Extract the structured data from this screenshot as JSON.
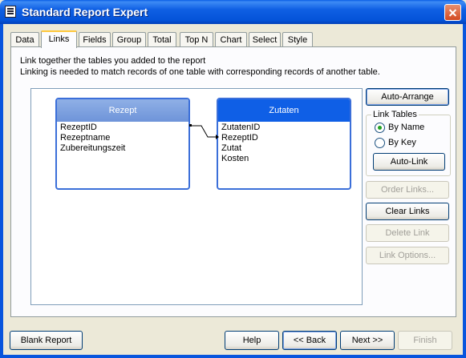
{
  "window": {
    "title": "Standard Report Expert",
    "icon": "report-app-icon",
    "close_icon": "close-icon"
  },
  "tabs": [
    {
      "label": "Data",
      "active": false
    },
    {
      "label": "Links",
      "active": true
    },
    {
      "label": "Fields",
      "active": false
    },
    {
      "label": "Group",
      "active": false
    },
    {
      "label": "Total",
      "active": false
    },
    {
      "label": "Top N",
      "active": false
    },
    {
      "label": "Chart",
      "active": false
    },
    {
      "label": "Select",
      "active": false
    },
    {
      "label": "Style",
      "active": false
    }
  ],
  "description": {
    "line1": "Link together the tables you added to the report",
    "line2": "Linking is needed to match records of one table with corresponding records of another table."
  },
  "tables": [
    {
      "name": "Rezept",
      "fields": [
        "RezeptID",
        "Rezeptname",
        "Zubereitungszeit"
      ]
    },
    {
      "name": "Zutaten",
      "fields": [
        "ZutatenID",
        "RezeptID",
        "Zutat",
        "Kosten"
      ]
    }
  ],
  "link": {
    "from": "Rezept.RezeptID",
    "to": "Zutaten.RezeptID"
  },
  "side": {
    "auto_arrange": "Auto-Arrange",
    "link_tables_label": "Link Tables",
    "by_name": "By Name",
    "by_key": "By Key",
    "selected_mode": "By Name",
    "auto_link": "Auto-Link",
    "order_links": "Order Links...",
    "clear_links": "Clear Links",
    "delete_link": "Delete Link",
    "link_options": "Link Options..."
  },
  "footer": {
    "blank_report": "Blank Report",
    "help": "Help",
    "back": "<< Back",
    "next": "Next >>",
    "finish": "Finish"
  },
  "colors": {
    "titlebar": "#0453d8",
    "active_tab_accent": "#ffc83c",
    "table_header_active": "#0f5fe6",
    "table_header_inactive": "#7a9edf"
  }
}
